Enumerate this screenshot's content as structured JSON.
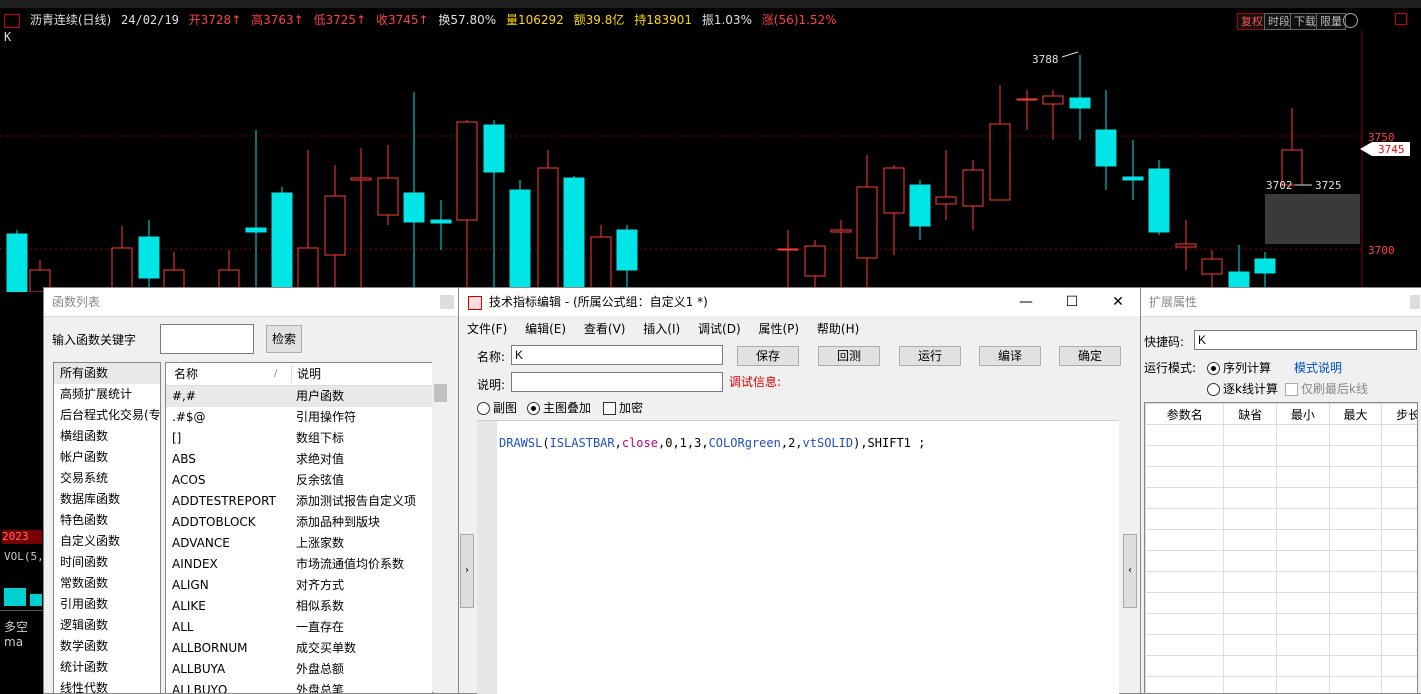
{
  "infobar": {
    "name": "沥青连续(日线)",
    "date": "24/02/19",
    "open": "开3728↑",
    "high": "高3763↑",
    "low": "低3725↑",
    "close": "收3745↑",
    "turnover": "换57.80%",
    "volume": "量106292",
    "amount": "额39.8亿",
    "hold": "持183901",
    "amplitude": "振1.03%",
    "change": "涨(56)1.52%",
    "k_label": "K",
    "buttons": [
      "复权",
      "时段",
      "下载",
      "限量"
    ]
  },
  "chart": {
    "price_labels": [
      "3750",
      "3700"
    ],
    "current_price": "3745",
    "high_marker": "3788",
    "marker_left": "3702",
    "marker_right": "3725",
    "colors": {
      "up": "#ff3c3c",
      "down": "#00e5e5",
      "grid": "#8a0000"
    }
  },
  "left_fragments": {
    "year": "2023",
    "vol": "VOL(5,",
    "duokong": "多空ma"
  },
  "func_panel": {
    "title": "函数列表",
    "keyword_label": "输入函数关键字",
    "search_value": "",
    "search_button": "检索",
    "categories": [
      "所有函数",
      "高频扩展统计",
      "后台程式化交易(专",
      "横组函数",
      "帐户函数",
      "交易系统",
      "数据库函数",
      "特色函数",
      "自定义函数",
      "时间函数",
      "常数函数",
      "引用函数",
      "逻辑函数",
      "数学函数",
      "统计函数",
      "线性代数"
    ],
    "col_name": "名称",
    "col_desc": "说明",
    "functions": [
      {
        "name": "#,#",
        "desc": "用户函数"
      },
      {
        "name": ".#$@",
        "desc": "引用操作符"
      },
      {
        "name": "[]",
        "desc": "数组下标"
      },
      {
        "name": "ABS",
        "desc": "求绝对值"
      },
      {
        "name": "ACOS",
        "desc": "反余弦值"
      },
      {
        "name": "ADDTESTREPORT",
        "desc": "添加测试报告自定义项"
      },
      {
        "name": "ADDTOBLOCK",
        "desc": "添加品种到版块"
      },
      {
        "name": "ADVANCE",
        "desc": "上涨家数"
      },
      {
        "name": "AINDEX",
        "desc": "市场流通值均价系数"
      },
      {
        "name": "ALIGN",
        "desc": "对齐方式"
      },
      {
        "name": "ALIKE",
        "desc": "相似系数"
      },
      {
        "name": "ALL",
        "desc": "一直存在"
      },
      {
        "name": "ALLBORNUM",
        "desc": "成交买单数"
      },
      {
        "name": "ALLBUYA",
        "desc": "外盘总额"
      },
      {
        "name": "ALLBUYQ",
        "desc": "外盘总笔"
      }
    ]
  },
  "editor": {
    "title": "技术指标编辑 - (所属公式组：自定义1 *)",
    "menu": [
      "文件(F)",
      "编辑(E)",
      "查看(V)",
      "插入(I)",
      "调试(D)",
      "属性(P)",
      "帮助(H)"
    ],
    "name_label": "名称:",
    "name_value": "K",
    "desc_label": "说明:",
    "desc_value": "",
    "debug_label": "调试信息:",
    "buttons": [
      "保存",
      "回测",
      "运行",
      "编译",
      "确定"
    ],
    "radio_sub": "副图",
    "radio_main": "主图叠加",
    "check_encrypt": "加密",
    "code": {
      "func": "DRAWSL",
      "arg1": "ISLASTBAR",
      "arg2": "close",
      "nums": "0,1,3,",
      "color": "COLORgreen",
      "num2": "2,",
      "style": "vtSOLID",
      "rest": "),SHIFT1 ;"
    }
  },
  "ext_panel": {
    "title": "扩展属性",
    "shortcut_label": "快捷码:",
    "shortcut_value": "K",
    "run_mode_label": "运行模式:",
    "mode_seq": "序列计算",
    "mode_link": "模式说明",
    "mode_tick": "逐k线计算",
    "only_last": "仅刷最后k线",
    "param_cols": [
      "参数名",
      "缺省",
      "最小",
      "最大",
      "步长"
    ]
  }
}
